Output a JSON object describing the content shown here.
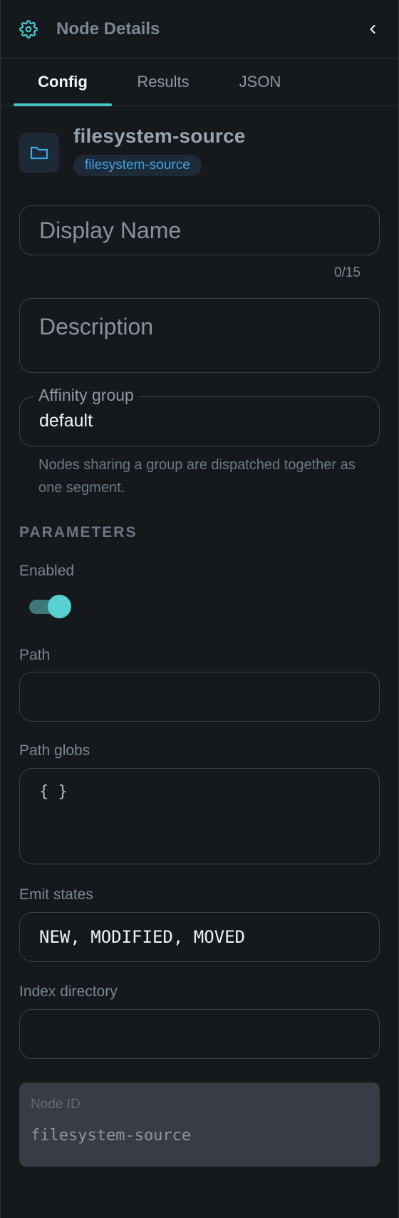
{
  "header": {
    "title": "Node Details",
    "icon": "gear-icon",
    "collapse_icon": "chevron-left-icon"
  },
  "tabs": [
    {
      "label": "Config",
      "active": true
    },
    {
      "label": "Results",
      "active": false
    },
    {
      "label": "JSON",
      "active": false
    }
  ],
  "source": {
    "icon": "folder-icon",
    "title": "filesystem-source",
    "badge": "filesystem-source"
  },
  "display_name": {
    "placeholder": "Display Name",
    "value": "",
    "counter": "0/15"
  },
  "description": {
    "placeholder": "Description",
    "value": ""
  },
  "affinity": {
    "label": "Affinity group",
    "value": "default",
    "helper": "Nodes sharing a group are dispatched together as one segment."
  },
  "parameters": {
    "heading": "PARAMETERS",
    "enabled": {
      "label": "Enabled",
      "value": true
    },
    "path": {
      "label": "Path",
      "value": ""
    },
    "path_globs": {
      "label": "Path globs",
      "value": "{ }"
    },
    "emit_states": {
      "label": "Emit states",
      "value": "NEW, MODIFIED, MOVED"
    },
    "index_directory": {
      "label": "Index directory",
      "value": ""
    }
  },
  "node_id": {
    "label": "Node ID",
    "value": "filesystem-source"
  },
  "colors": {
    "accent": "#45c7c7",
    "background": "#15191d",
    "badge_text": "#3fa6ea"
  }
}
